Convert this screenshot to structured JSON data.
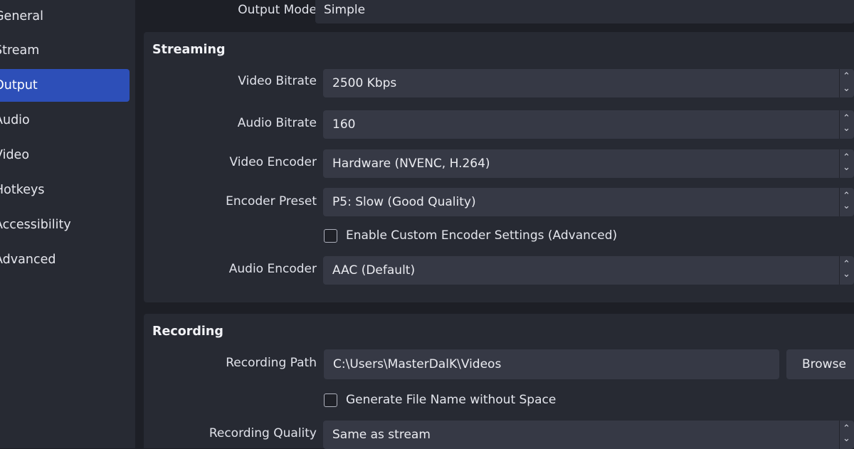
{
  "sidebar": {
    "items": [
      {
        "label": "General"
      },
      {
        "label": "Stream"
      },
      {
        "label": "Output"
      },
      {
        "label": "Audio"
      },
      {
        "label": "Video"
      },
      {
        "label": "Hotkeys"
      },
      {
        "label": "Accessibility"
      },
      {
        "label": "Advanced"
      }
    ],
    "active": "Output"
  },
  "output_mode": {
    "label": "Output Mode",
    "value": "Simple"
  },
  "streaming": {
    "title": "Streaming",
    "video_bitrate": {
      "label": "Video Bitrate",
      "value": "2500 Kbps"
    },
    "audio_bitrate": {
      "label": "Audio Bitrate",
      "value": "160"
    },
    "video_encoder": {
      "label": "Video Encoder",
      "value": "Hardware (NVENC, H.264)"
    },
    "encoder_preset": {
      "label": "Encoder Preset",
      "value": "P5: Slow (Good Quality)"
    },
    "custom_encoder": {
      "label": "Enable Custom Encoder Settings (Advanced)",
      "checked": false
    },
    "audio_encoder": {
      "label": "Audio Encoder",
      "value": "AAC (Default)"
    }
  },
  "recording": {
    "title": "Recording",
    "path": {
      "label": "Recording Path",
      "value": "C:\\Users\\MasterDalK\\Videos"
    },
    "browse_label": "Browse",
    "no_space": {
      "label": "Generate File Name without Space",
      "checked": false
    },
    "quality": {
      "label": "Recording Quality",
      "value": "Same as stream"
    }
  },
  "icons": {
    "spin_up": "chevron-up-icon",
    "spin_down": "chevron-down-icon"
  },
  "colors": {
    "accent": "#2d4fb8",
    "background": "#1d1f26",
    "panel": "#272a33",
    "field": "#363945"
  }
}
